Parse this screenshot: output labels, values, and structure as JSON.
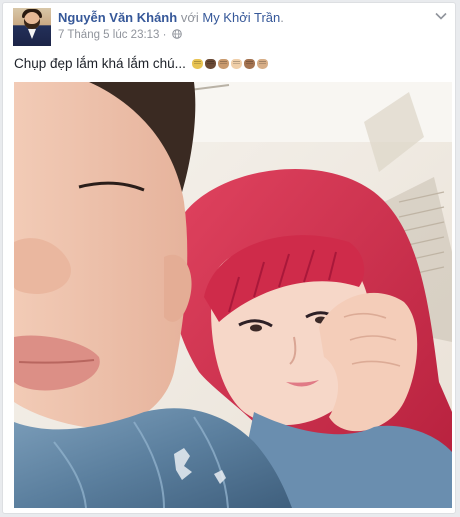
{
  "post": {
    "author": "Nguyễn Văn Khánh",
    "with_word": "với",
    "tagged": "My Khởi Trần",
    "tagged_suffix": ".",
    "timestamp": "7 Tháng 5 lúc 23:13",
    "separator": "·",
    "privacy_icon": "globe-icon",
    "menu_icon": "chevron-down-icon",
    "text": "Chụp đẹp lắm khá lắm chú...",
    "emoji": [
      {
        "name": "fist-emoji",
        "color": "#e8c352"
      },
      {
        "name": "fist-emoji",
        "color": "#6b4a35"
      },
      {
        "name": "fist-emoji",
        "color": "#c99a6e"
      },
      {
        "name": "fist-emoji",
        "color": "#f0cfa9"
      },
      {
        "name": "fist-emoji",
        "color": "#a47350"
      },
      {
        "name": "fist-emoji",
        "color": "#d7ae87"
      }
    ],
    "photo": "selfie-photo"
  },
  "colors": {
    "link": "#365899",
    "meta": "#90949c",
    "text": "#1d2129",
    "hair_red": "#d8324f",
    "jacket_denim": "#5b7f9e"
  }
}
